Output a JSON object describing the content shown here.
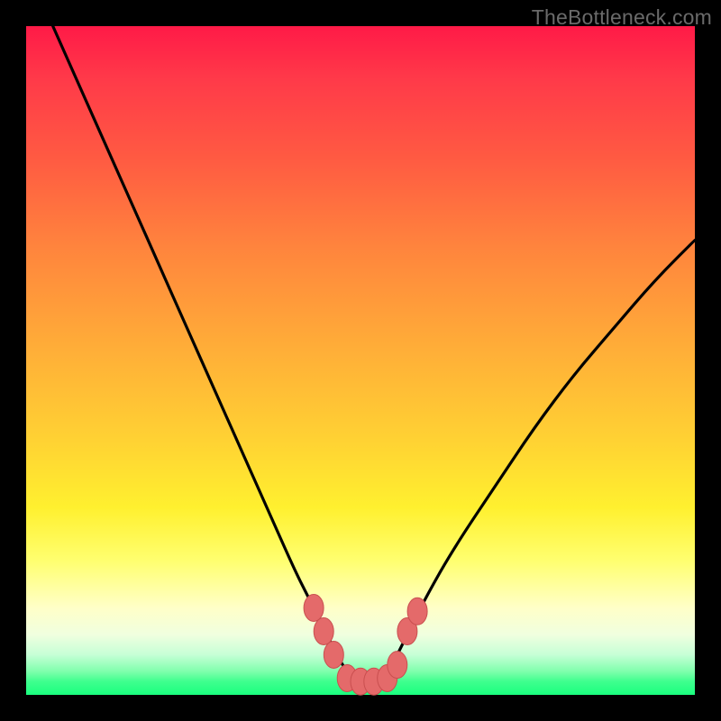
{
  "watermark": "TheBottleneck.com",
  "chart_data": {
    "type": "line",
    "title": "",
    "xlabel": "",
    "ylabel": "",
    "xlim": [
      0,
      100
    ],
    "ylim": [
      0,
      100
    ],
    "grid": false,
    "series": [
      {
        "name": "bottleneck-curve",
        "x": [
          4,
          8,
          12,
          16,
          20,
          24,
          28,
          32,
          36,
          40,
          42,
          44,
          46,
          47,
          48,
          49,
          50,
          51,
          52,
          53,
          54,
          55,
          56,
          58,
          60,
          64,
          70,
          76,
          82,
          88,
          94,
          100
        ],
        "values": [
          100,
          91,
          82,
          73,
          64,
          55,
          46,
          37,
          28,
          19,
          15,
          11,
          7,
          5,
          3.5,
          2.5,
          2,
          2,
          2,
          2.5,
          3.5,
          5,
          7,
          11,
          15,
          22,
          31,
          40,
          48,
          55,
          62,
          68
        ]
      }
    ],
    "markers": [
      {
        "name": "left-marker-1",
        "x": 43,
        "y": 13
      },
      {
        "name": "left-marker-2",
        "x": 44.5,
        "y": 9.5
      },
      {
        "name": "left-marker-3",
        "x": 46,
        "y": 6
      },
      {
        "name": "right-marker-1",
        "x": 57,
        "y": 9.5
      },
      {
        "name": "right-marker-2",
        "x": 58.5,
        "y": 12.5
      },
      {
        "name": "valley-marker-1",
        "x": 48,
        "y": 2.5
      },
      {
        "name": "valley-marker-2",
        "x": 50,
        "y": 2
      },
      {
        "name": "valley-marker-3",
        "x": 52,
        "y": 2
      },
      {
        "name": "valley-marker-4",
        "x": 54,
        "y": 2.5
      },
      {
        "name": "valley-marker-5",
        "x": 55.5,
        "y": 4.5
      }
    ],
    "colors": {
      "curve": "#000000",
      "marker_fill": "#e46a6a",
      "marker_stroke": "#c94f4f"
    }
  }
}
